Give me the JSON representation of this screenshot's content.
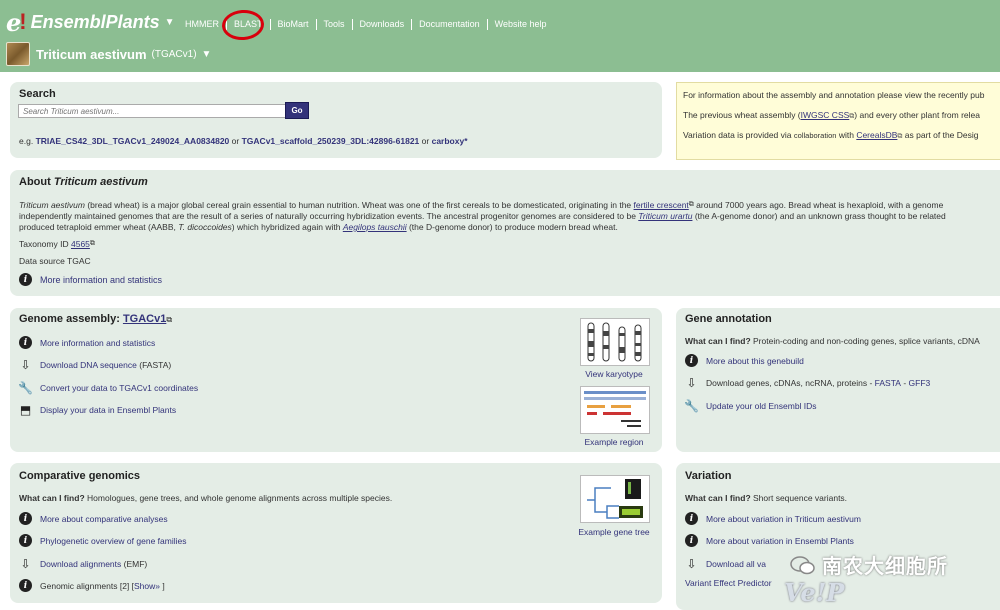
{
  "header": {
    "logo_e": "e",
    "logo_bang": "!",
    "site_name": "EnsemblPlants",
    "nav": [
      "HMMER",
      "BLAST",
      "BioMart",
      "Tools",
      "Downloads",
      "Documentation",
      "Website help"
    ],
    "species_name": "Triticum aestivum",
    "assembly": "(TGACv1)"
  },
  "search": {
    "title": "Search",
    "placeholder": "Search Triticum aestivum...",
    "go_label": "Go",
    "eg_prefix": "e.g.",
    "example1": "TRIAE_CS42_3DL_TGACv1_249024_AA0834820",
    "or1": "or",
    "example2": "TGACv1_scaffold_250239_3DL:42896-61821",
    "or2": "or",
    "example3": "carboxy*"
  },
  "info_box": {
    "line1": "For information about the assembly and annotation please view the recently pub",
    "line2a": "The previous wheat assembly (",
    "line2_link": "IWGSC CSS",
    "line2b": ") and every other plant from relea",
    "line3a": "Variation data is provided via",
    "line3_collab": "collaboration",
    "line3b": "with",
    "line3_link": "CerealsDB",
    "line3c": "as part of the Desig"
  },
  "about": {
    "title_prefix": "About",
    "title_species": "Triticum aestivum",
    "p1_species": "Triticum aestivum",
    "p1a": " (bread wheat) is a major global cereal grain essential to human nutrition. Wheat was one of the first cereals to be domesticated, originating in the ",
    "p1_link": "fertile crescent",
    "p1b": " around 7000 years ago. Bread wheat is hexaploid, with a genome",
    "p2a": "independently maintained genomes that are the result of a series of naturally occurring hybridization events. The ancestral progenitor genomes are considered to be ",
    "p2_link": "Triticum urartu",
    "p2b": " (the A-genome donor) and an unknown grass thought to be related",
    "p3a": "produced tetraploid emmer wheat (AABB, ",
    "p3_italic": "T. dicoccoides",
    "p3b": ") which hybridized again with ",
    "p3_link": "Aegilops tauschii",
    "p3c": " (the D-genome donor) to produce modern bread wheat.",
    "taxonomy_label": "Taxonomy ID",
    "taxonomy_id": "4565",
    "data_source": "Data source TGAC",
    "more_info": "More information and statistics"
  },
  "genome_assembly": {
    "title_prefix": "Genome assembly:",
    "title_link": "TGACv1",
    "items": [
      {
        "icon": "info-icon",
        "label": "More information and statistics",
        "suffix": ""
      },
      {
        "icon": "download-icon",
        "label": "Download DNA sequence",
        "suffix": "(FASTA)"
      },
      {
        "icon": "wrench-icon",
        "label": "Convert your data to TGACv1 coordinates",
        "suffix": ""
      },
      {
        "icon": "display-icon",
        "label": "Display your data in Ensembl Plants",
        "suffix": ""
      }
    ],
    "karyotype_caption": "View karyotype",
    "region_caption": "Example region"
  },
  "gene_annotation": {
    "title": "Gene annotation",
    "find_bold": "What can I find?",
    "find_text": "Protein-coding and non-coding genes, splice variants, cDNA",
    "items": [
      {
        "icon": "info-icon",
        "label": "More about this genebuild"
      },
      {
        "icon": "download-icon",
        "label": "Download genes, cDNAs, ncRNA, proteins - ",
        "link1": "FASTA",
        "sep": " - ",
        "link2": "GFF3"
      },
      {
        "icon": "wrench-icon",
        "label": "Update your old Ensembl IDs"
      }
    ]
  },
  "comparative": {
    "title": "Comparative genomics",
    "find_bold": "What can I find?",
    "find_text": "Homologues, gene trees, and whole genome alignments across multiple species.",
    "items": [
      {
        "icon": "info-icon",
        "label": "More about comparative analyses"
      },
      {
        "icon": "info-icon",
        "label": "Phylogenetic overview of gene families"
      },
      {
        "icon": "download-icon",
        "label": "Download alignments",
        "suffix": "(EMF)"
      }
    ],
    "genomic_alignments": "Genomic alignments [2] [",
    "show_link": "Show»",
    "genomic_alignments_end": " ]",
    "gene_tree_caption": "Example gene tree"
  },
  "variation": {
    "title": "Variation",
    "find_bold": "What can I find?",
    "find_text": "Short sequence variants.",
    "items": [
      {
        "icon": "info-icon",
        "label": "More about variation in Triticum aestivum"
      },
      {
        "icon": "info-icon",
        "label": "More about variation in Ensembl Plants"
      },
      {
        "icon": "download-icon",
        "label": "Download all va"
      }
    ],
    "vep": "Variant Effect Predictor"
  },
  "watermark": {
    "text": "南农大细胞所",
    "logo": "Ve!P"
  }
}
